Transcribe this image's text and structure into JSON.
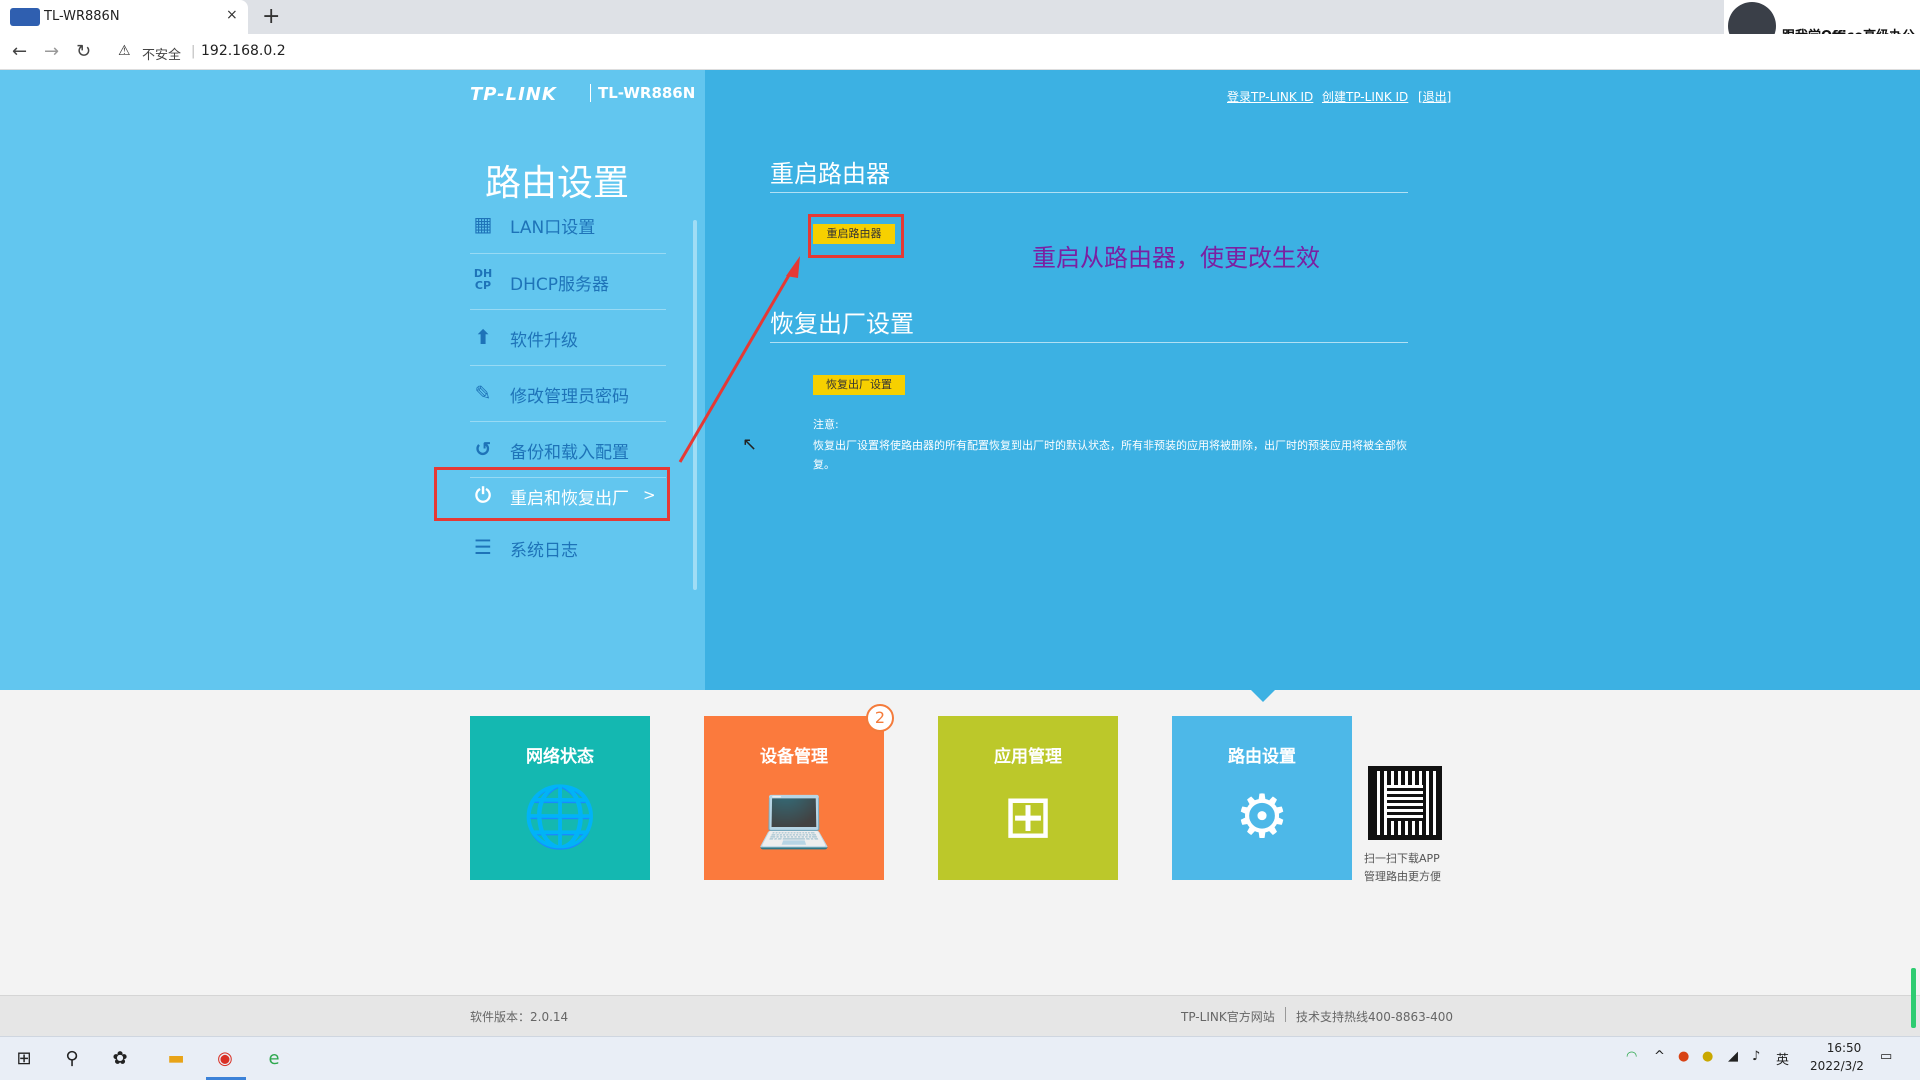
{
  "browser": {
    "tab_title": "TL-WR886N",
    "tab_close": "×",
    "new_tab": "+",
    "insecure_label": "不安全",
    "url": "192.168.0.2",
    "profile_name": "跟我学Office高级办公"
  },
  "header": {
    "brand": "TP-LINK",
    "model": "TL-WR886N",
    "links": [
      "登录TP-LINK ID",
      "创建TP-LINK ID",
      "[退出]"
    ]
  },
  "sidebar": {
    "title": "路由设置",
    "items": [
      {
        "label": "LAN口设置",
        "icon": "lan-icon"
      },
      {
        "label": "DHCP服务器",
        "icon": "dhcp-icon"
      },
      {
        "label": "软件升级",
        "icon": "upload-icon"
      },
      {
        "label": "修改管理员密码",
        "icon": "pencil-icon"
      },
      {
        "label": "备份和载入配置",
        "icon": "history-icon"
      },
      {
        "label": "重启和恢复出厂",
        "icon": "power-icon"
      },
      {
        "label": "系统日志",
        "icon": "list-icon"
      }
    ],
    "active_arrow": ">"
  },
  "main": {
    "reboot": {
      "title": "重启路由器",
      "button": "重启路由器"
    },
    "annotation": "重启从路由器，使更改生效",
    "factory": {
      "title": "恢复出厂设置",
      "button": "恢复出厂设置",
      "note_label": "注意:",
      "note_text": "恢复出厂设置将使路由器的所有配置恢复到出厂时的默认状态，所有非预装的应用将被删除，出厂时的预装应用将被全部恢复。"
    }
  },
  "tiles": [
    {
      "label": "网络状态",
      "color": "#14b8b1",
      "icon": "globe-icon"
    },
    {
      "label": "设备管理",
      "color": "#fb7a3d",
      "icon": "laptop-icon",
      "badge": "2"
    },
    {
      "label": "应用管理",
      "color": "#bcc82a",
      "icon": "apps-icon"
    },
    {
      "label": "路由设置",
      "color": "#4db8e8",
      "icon": "gear-icon"
    }
  ],
  "qr": {
    "line1": "扫一扫下载APP",
    "line2": "管理路由更方便"
  },
  "footer": {
    "version": "软件版本：2.0.14",
    "site": "TP-LINK官方网站",
    "hotline": "技术支持热线400-8863-400"
  },
  "taskbar": {
    "time": "16:50",
    "date": "2022/3/2",
    "ime": "英"
  },
  "colors": {
    "hero": "#3cb1e3",
    "sidebar": "#62c6ef",
    "highlight": "#e53935",
    "button": "#f7d000",
    "annotation": "#7b1fa2"
  }
}
